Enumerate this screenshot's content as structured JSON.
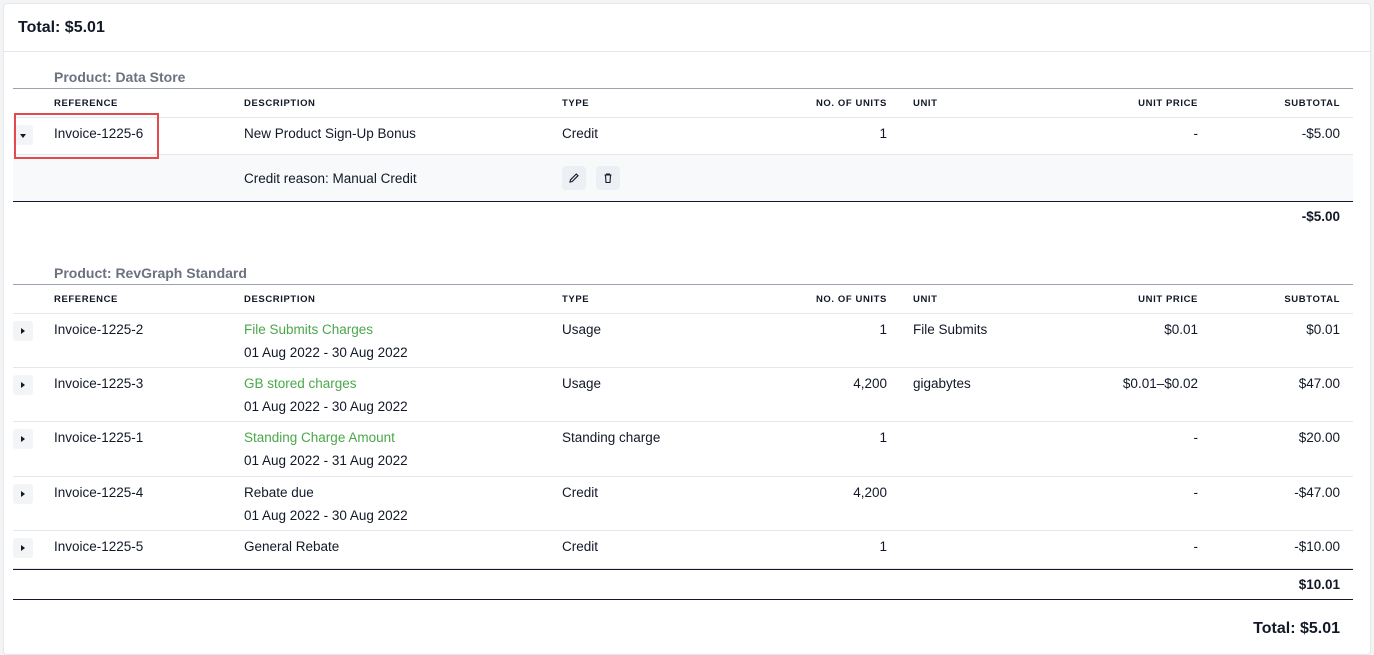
{
  "header": {
    "total_label": "Total: $5.01"
  },
  "columns": {
    "reference": "REFERENCE",
    "description": "DESCRIPTION",
    "type": "TYPE",
    "units": "NO. OF UNITS",
    "unit": "UNIT",
    "unit_price": "UNIT PRICE",
    "subtotal": "SUBTOTAL"
  },
  "sections": [
    {
      "title": "Product: Data Store",
      "rows": [
        {
          "reference": "Invoice-1225-6",
          "description": "New Product Sign-Up Bonus",
          "period": "",
          "type": "Credit",
          "units": "1",
          "unit": "",
          "unit_price": "-",
          "subtotal": "-$5.00",
          "expanded": true
        }
      ],
      "detail": {
        "credit_reason": "Credit reason: Manual Credit",
        "edit_icon": "pencil-icon",
        "delete_icon": "trash-icon"
      },
      "total": "-$5.00"
    },
    {
      "title": "Product: RevGraph Standard",
      "rows": [
        {
          "reference": "Invoice-1225-2",
          "description": "File Submits Charges",
          "period": "01 Aug 2022 - 30 Aug 2022",
          "type": "Usage",
          "units": "1",
          "unit": "File Submits",
          "unit_price": "$0.01",
          "subtotal": "$0.01"
        },
        {
          "reference": "Invoice-1225-3",
          "description": "GB stored charges",
          "period": "01 Aug 2022 - 30 Aug 2022",
          "type": "Usage",
          "units": "4,200",
          "unit": "gigabytes",
          "unit_price": "$0.01–$0.02",
          "subtotal": "$47.00"
        },
        {
          "reference": "Invoice-1225-1",
          "description": "Standing Charge Amount",
          "period": "01 Aug 2022 - 31 Aug 2022",
          "type": "Standing charge",
          "units": "1",
          "unit": "",
          "unit_price": "-",
          "subtotal": "$20.00"
        },
        {
          "reference": "Invoice-1225-4",
          "description": "Rebate due",
          "period": "01 Aug 2022 - 30 Aug 2022",
          "type": "Credit",
          "units": "4,200",
          "unit": "",
          "unit_price": "-",
          "subtotal": "-$47.00"
        },
        {
          "reference": "Invoice-1225-5",
          "description": "General Rebate",
          "period": "",
          "type": "Credit",
          "units": "1",
          "unit": "",
          "unit_price": "-",
          "subtotal": "-$10.00"
        }
      ],
      "total": "$10.01"
    }
  ],
  "footer": {
    "grand_total": "Total: $5.01"
  },
  "colors": {
    "link_green": "#4aa84a",
    "highlight_red": "#e5484d"
  }
}
